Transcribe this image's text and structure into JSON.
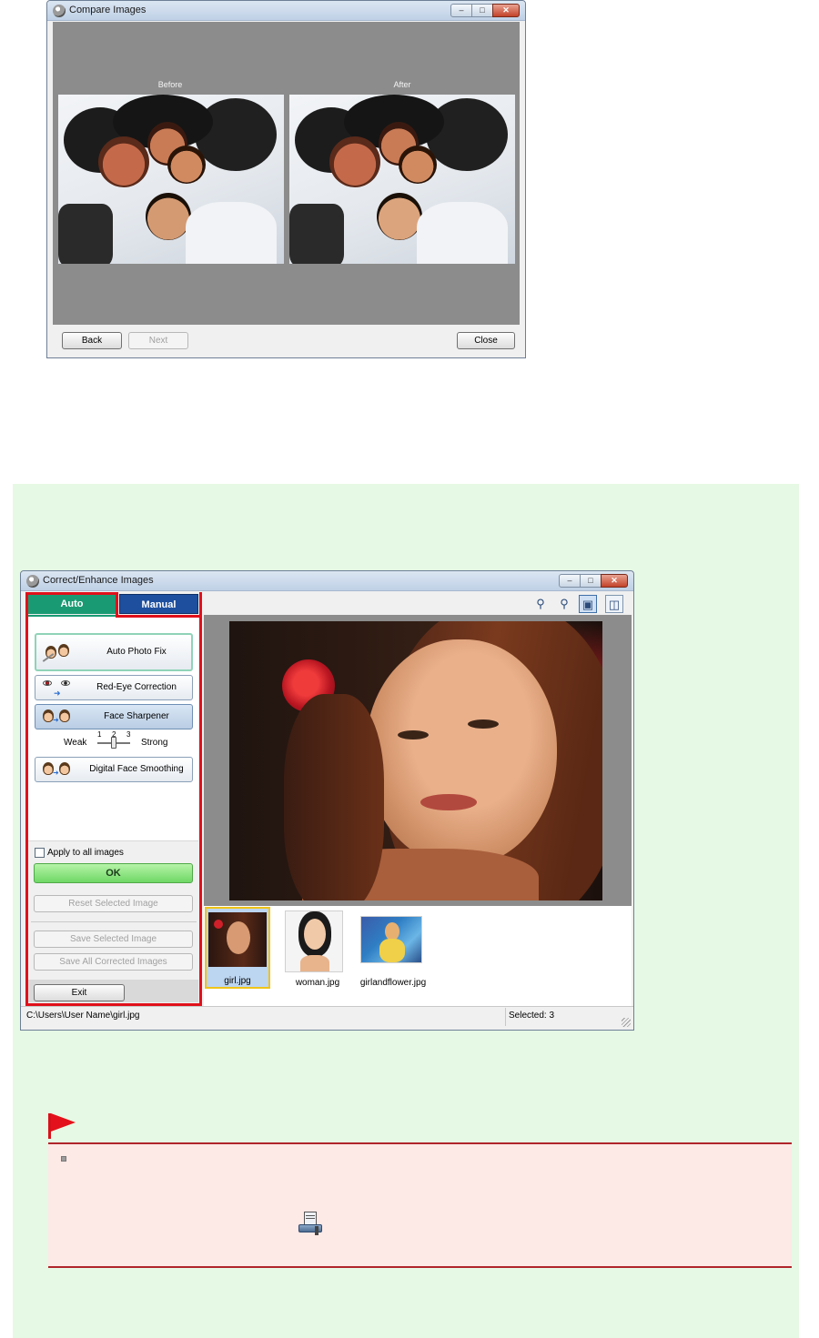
{
  "compare_window": {
    "title": "Compare Images",
    "before_label": "Before",
    "after_label": "After",
    "back_button": "Back",
    "next_button": "Next",
    "close_button": "Close"
  },
  "enhance_window": {
    "title": "Correct/Enhance Images",
    "tabs": {
      "auto": "Auto",
      "manual": "Manual",
      "active": "Auto"
    },
    "toolbar_icons": [
      "zoom-in-icon",
      "zoom-out-icon",
      "whole-image-view-icon",
      "compare-view-icon"
    ],
    "buttons": {
      "auto_photo_fix": "Auto Photo Fix",
      "red_eye_correction": "Red-Eye Correction",
      "face_sharpener": "Face Sharpener",
      "digital_face_smoothing": "Digital Face Smoothing"
    },
    "strength": {
      "weak_label": "Weak",
      "strong_label": "Strong",
      "ticks": [
        "1",
        "2",
        "3"
      ],
      "value": 2
    },
    "apply_all_label": "Apply to all images",
    "apply_all_checked": false,
    "ok_button": "OK",
    "reset_button": "Reset Selected Image",
    "save_selected_button": "Save Selected Image",
    "save_all_button": "Save All Corrected Images",
    "exit_button": "Exit",
    "thumbnails": [
      {
        "label": "girl.jpg",
        "selected": true
      },
      {
        "label": "woman.jpg",
        "selected": false
      },
      {
        "label": "girlandflower.jpg",
        "selected": false
      }
    ],
    "status_path": "C:\\Users\\User Name\\girl.jpg",
    "status_selected": "Selected: 3"
  },
  "colors": {
    "auto_tab": "#1a9a73",
    "manual_tab": "#1d4f9e",
    "highlight_frame": "#e0101a",
    "ok_button": "#7fe07a",
    "panel_background": "#e6f9e4",
    "note_background": "#fde9e6",
    "note_rule": "#b0242a"
  },
  "note": {
    "flag_icon": "red-flag-icon",
    "bullet_icon": "square-bullet-icon",
    "inline_icon": "settings-tool-icon"
  }
}
